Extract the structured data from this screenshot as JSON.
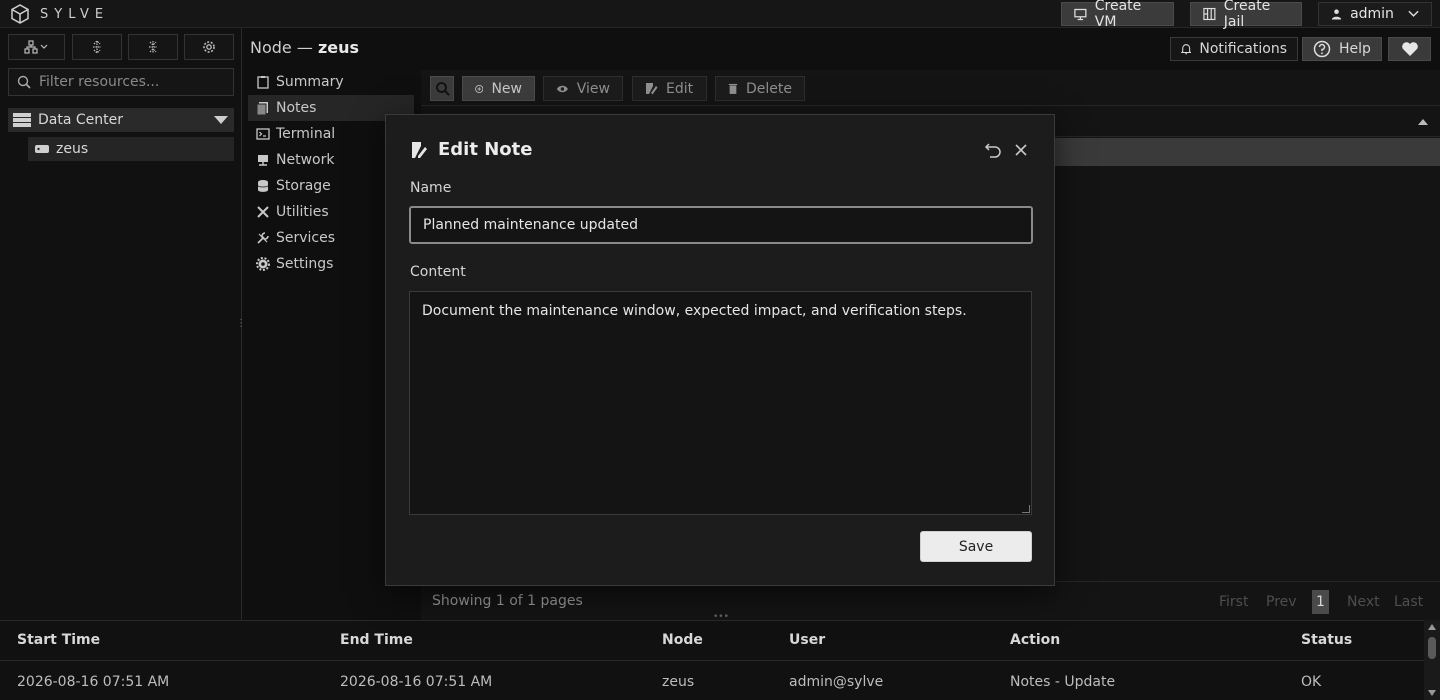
{
  "app": {
    "brand": "SYLVE",
    "create_vm": "Create VM",
    "create_jail": "Create Jail",
    "user": "admin"
  },
  "left": {
    "filter_placeholder": "Filter resources...",
    "tree": {
      "datacenter": "Data Center",
      "node": "zeus"
    }
  },
  "page": {
    "title_prefix": "Node — ",
    "title_node": "zeus"
  },
  "nav": [
    {
      "label": "Summary",
      "icon": "clipboard-icon"
    },
    {
      "label": "Notes",
      "icon": "notes-icon",
      "active": true
    },
    {
      "label": "Terminal",
      "icon": "terminal-icon"
    },
    {
      "label": "Network",
      "icon": "network-icon"
    },
    {
      "label": "Storage",
      "icon": "database-icon"
    },
    {
      "label": "Utilities",
      "icon": "tools-icon"
    },
    {
      "label": "Services",
      "icon": "wrench-icon"
    },
    {
      "label": "Settings",
      "icon": "gear-icon"
    }
  ],
  "header": {
    "notifications": "Notifications",
    "help": "Help"
  },
  "toolbar": {
    "new": "New",
    "view": "View",
    "edit": "Edit",
    "delete": "Delete"
  },
  "footer": {
    "showing": "Showing 1 of 1 pages",
    "first": "First",
    "prev": "Prev",
    "current_page": "1",
    "next": "Next",
    "last": "Last"
  },
  "modal": {
    "title": "Edit Note",
    "name_label": "Name",
    "name_value": "Planned maintenance updated",
    "content_label": "Content",
    "content_value": "Document the maintenance window, expected impact, and verification steps.",
    "save": "Save"
  },
  "log": {
    "columns": [
      "Start Time",
      "End Time",
      "Node",
      "User",
      "Action",
      "Status"
    ],
    "rows": [
      [
        "2026-08-16 07:51 AM",
        "2026-08-16 07:51 AM",
        "zeus",
        "admin@sylve",
        "Notes - Update",
        "OK"
      ]
    ]
  }
}
